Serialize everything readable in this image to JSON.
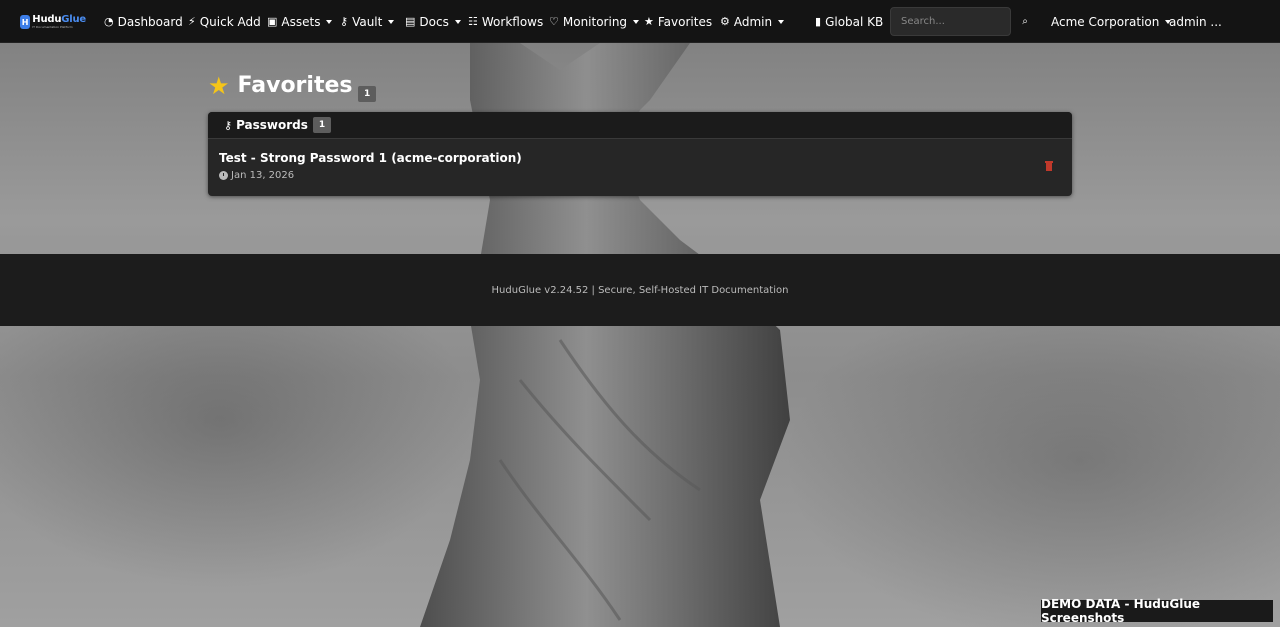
{
  "brand": {
    "name_a": "Hudu",
    "name_b": "Glue",
    "tagline": "IT Documentation Platform"
  },
  "nav": {
    "dashboard": "Dashboard",
    "quick_add": "Quick Add",
    "assets": "Assets",
    "vault": "Vault",
    "docs": "Docs",
    "workflows": "Workflows",
    "monitoring": "Monitoring",
    "favorites": "Favorites",
    "admin": "Admin",
    "global_kb": "Global KB",
    "company": "Acme Corporation",
    "user": "admin ..."
  },
  "search": {
    "placeholder": "Search..."
  },
  "page": {
    "title": "Favorites",
    "count": "1"
  },
  "passwords_card": {
    "heading": "Passwords",
    "count": "1",
    "items": [
      {
        "title": "Test - Strong Password 1 (acme-corporation)",
        "date": "Jan 13, 2026"
      }
    ]
  },
  "footer": {
    "text": "HuduGlue v2.24.52 | Secure, Self-Hosted IT Documentation"
  },
  "demo_badge": "DEMO DATA - HuduGlue Screenshots",
  "colors": {
    "navbar_bg": "#141414",
    "accent_star": "#f5c518",
    "delete_red": "#c0392b",
    "brand_blue": "#3d7ee8"
  }
}
